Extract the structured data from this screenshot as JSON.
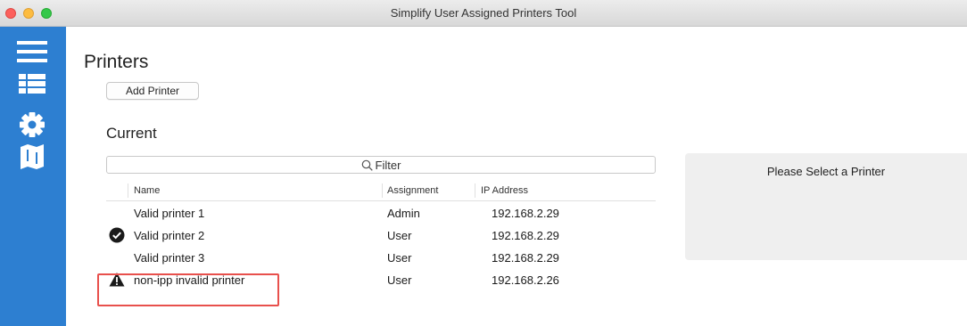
{
  "window": {
    "title": "Simplify User Assigned Printers Tool"
  },
  "sidebar": {
    "items": [
      {
        "icon": "menu-icon"
      },
      {
        "icon": "list-icon"
      },
      {
        "icon": "gear-icon"
      },
      {
        "icon": "map-icon"
      }
    ]
  },
  "main": {
    "title": "Printers",
    "add_button_label": "Add Printer",
    "section_title": "Current",
    "filter_placeholder": "Filter",
    "table": {
      "headers": {
        "name": "Name",
        "assignment": "Assignment",
        "ip": "IP Address"
      },
      "rows": [
        {
          "status_icon": "",
          "name": "Valid printer 1",
          "assignment": "Admin",
          "ip": "192.168.2.29"
        },
        {
          "status_icon": "checkmark-circle-icon",
          "name": "Valid printer 2",
          "assignment": "User",
          "ip": "192.168.2.29"
        },
        {
          "status_icon": "",
          "name": "Valid printer 3",
          "assignment": "User",
          "ip": "192.168.2.29"
        },
        {
          "status_icon": "warning-icon",
          "name": "non-ipp invalid printer",
          "assignment": "User",
          "ip": "192.168.2.26"
        }
      ]
    }
  },
  "detail": {
    "placeholder": "Please Select a Printer"
  },
  "colors": {
    "sidebar": "#2d7fd1",
    "highlight": "#e8504c",
    "detail_bg": "#efefef"
  }
}
